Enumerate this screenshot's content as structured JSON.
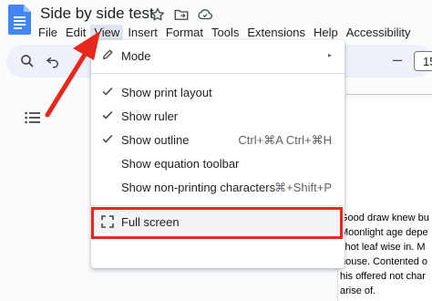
{
  "app": {
    "doc_title": "Side by side test"
  },
  "menubar": {
    "items": [
      "File",
      "Edit",
      "View",
      "Insert",
      "Format",
      "Tools",
      "Extensions",
      "Help",
      "Accessibility"
    ],
    "active": "View"
  },
  "toolbar": {
    "font_size": "15",
    "minus": "–"
  },
  "view_menu": {
    "mode_label": "Mode",
    "submenu_arrow": "▸",
    "show_print_layout": "Show print layout",
    "show_ruler": "Show ruler",
    "show_outline": "Show outline",
    "show_outline_shortcut": "Ctrl+⌘A Ctrl+⌘H",
    "show_equation_toolbar": "Show equation toolbar",
    "show_nonprinting": "Show non-printing characters",
    "show_nonprinting_shortcut": "⌘+Shift+P",
    "full_screen": "Full screen",
    "checked": {
      "show_print_layout": true,
      "show_ruler": true,
      "show_outline": true
    }
  },
  "document": {
    "lines": [
      "Good draw knew bu",
      "Moonlight age depe",
      "shot leaf wise in. M",
      "house. Contented o",
      "his offered not char",
      "arise of."
    ]
  },
  "icons": {
    "logo": "google-docs-logo",
    "star": "star-icon",
    "folder": "move-to-folder-icon",
    "cloud": "cloud-saved-icon"
  },
  "colors": {
    "highlight_red": "#e8271d",
    "docs_blue": "#4285f4",
    "menu_active_bg": "#dfe3eb",
    "toolbar_bg": "#edf2fa"
  }
}
